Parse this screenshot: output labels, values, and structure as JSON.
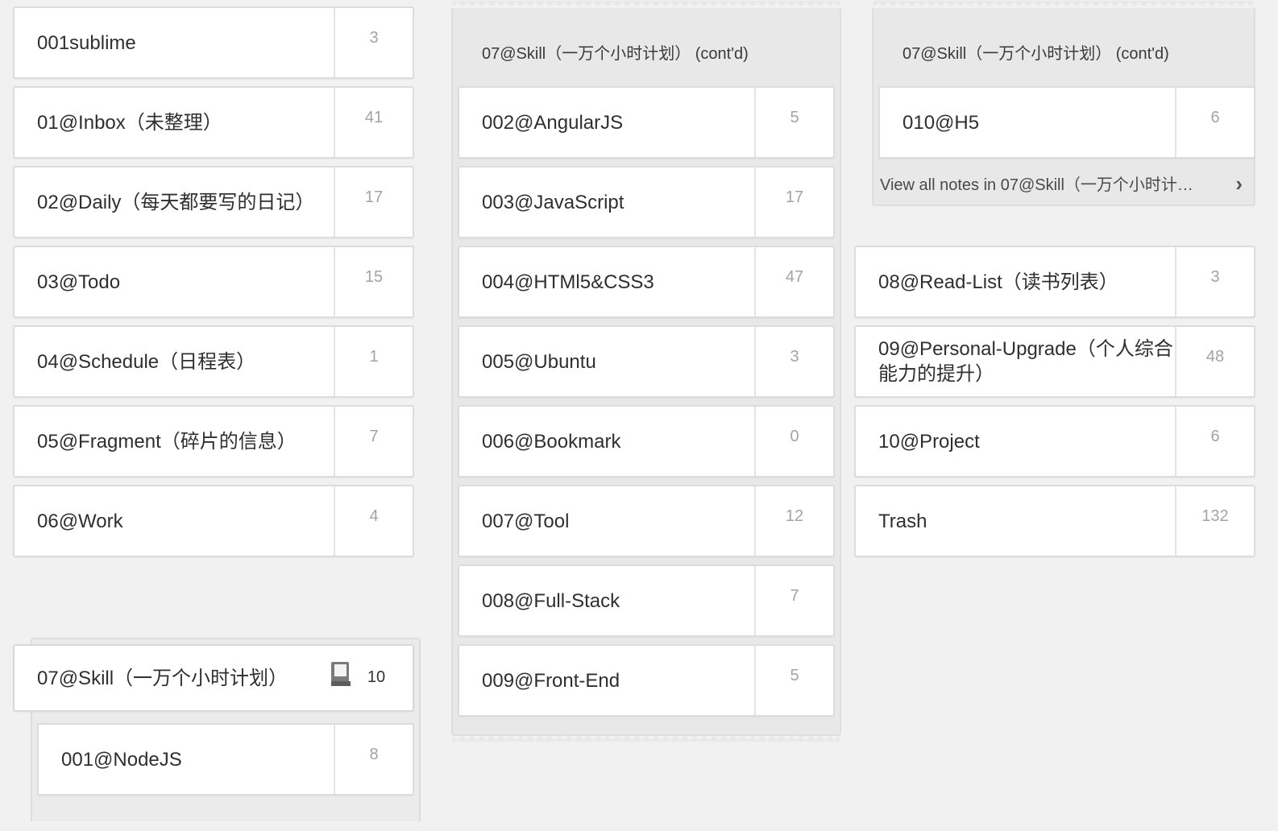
{
  "left_column": [
    {
      "name": "001sublime",
      "count": "3"
    },
    {
      "name": "01@Inbox（未整理）",
      "count": "41"
    },
    {
      "name": "02@Daily（每天都要写的日记）",
      "count": "17"
    },
    {
      "name": "03@Todo",
      "count": "15"
    },
    {
      "name": "04@Schedule（日程表）",
      "count": "1"
    },
    {
      "name": "05@Fragment（碎片的信息）",
      "count": "7"
    },
    {
      "name": "06@Work",
      "count": "4"
    }
  ],
  "skill_stack": {
    "name": "07@Skill（一万个小时计划）",
    "count": "10",
    "icon": "stack-icon",
    "cont_title": "07@Skill（一万个小时计划） (cont'd)",
    "first_child": {
      "name": "001@NodeJS",
      "count": "8"
    },
    "middle_children": [
      {
        "name": "002@AngularJS",
        "count": "5"
      },
      {
        "name": "003@JavaScript",
        "count": "17"
      },
      {
        "name": "004@HTMl5&CSS3",
        "count": "47"
      },
      {
        "name": "005@Ubuntu",
        "count": "3"
      },
      {
        "name": "006@Bookmark",
        "count": "0"
      },
      {
        "name": "007@Tool",
        "count": "12"
      },
      {
        "name": "008@Full-Stack",
        "count": "7"
      },
      {
        "name": "009@Front-End",
        "count": "5"
      }
    ],
    "last_child": {
      "name": "010@H5",
      "count": "6"
    },
    "view_all": "View all notes in 07@Skill（一万个小时计…"
  },
  "right_column": [
    {
      "name": "08@Read-List（读书列表）",
      "count": "3"
    },
    {
      "name": "09@Personal-Upgrade（个人综合能力的提升）",
      "count": "48"
    },
    {
      "name": "10@Project",
      "count": "6"
    },
    {
      "name": "Trash",
      "count": "132"
    }
  ]
}
